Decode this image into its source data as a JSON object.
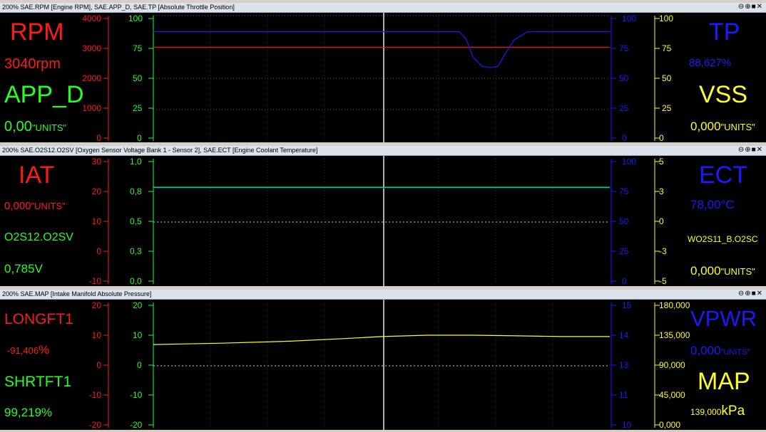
{
  "colors": {
    "red": "#ff1a1a",
    "green": "#22ff22",
    "blue": "#1a1aff",
    "yellow": "#ffff22",
    "gray": "#bdbdbd"
  },
  "window_controls": "⊖⊕■✕",
  "panels": [
    {
      "title": "200% SAE.RPM [Engine RPM], SAE.APP_D, SAE.TP [Absolute Throttle Position]",
      "left": {
        "name1": "RPM",
        "value1": "3040rpm",
        "name2": "APP_D",
        "value2": "0,00",
        "unit2": "\"UNITS\""
      },
      "right": {
        "name1": "TP",
        "value1": "88,627%",
        "name2": "VSS",
        "value2": "0,000",
        "unit2": "\"UNITS\""
      },
      "axis_red": [
        "4000",
        "3000",
        "2000",
        "1000",
        "0"
      ],
      "axis_green": [
        "100",
        "75",
        "50",
        "25",
        "0"
      ],
      "axis_blue": [
        "100",
        "75",
        "50",
        "25",
        "0"
      ],
      "axis_yellow": [
        "100",
        "75",
        "50",
        "25",
        "0"
      ]
    },
    {
      "title": "200% SAE.O2S12.O2SV [Oxygen Sensor Voltage Bank 1 - Sensor 2], SAE.ECT [Engine Coolant Temperature]",
      "left": {
        "name1": "IAT",
        "value1": "0,000",
        "unit1": "\"UNITS\"",
        "name2": "O2S12.O2SV",
        "value2": "0,785V"
      },
      "right": {
        "name1": "ECT",
        "value1": "78,00°C",
        "name2": "WO2S11_B.O2SC",
        "value2": "0,000",
        "unit2": "\"UNITS\""
      },
      "axis_red": [
        "30",
        "20",
        "10",
        "0",
        "-10"
      ],
      "axis_green": [
        "1,0",
        "0,8",
        "0,5",
        "0,3",
        "0,0"
      ],
      "axis_blue": [
        "100",
        "75",
        "50",
        "25",
        "0"
      ],
      "axis_yellow": [
        "5",
        "3",
        "0",
        "-3",
        "-5"
      ]
    },
    {
      "title": "200% SAE.MAP [Intake Manifold Absolute Pressure]",
      "left": {
        "name1": "LONGFT1",
        "value1": "-91,406",
        "unit1": "%",
        "name2": "SHRTFT1",
        "value2": "99,219%"
      },
      "right": {
        "name1": "VPWR",
        "value1": "0,000",
        "unit1": "\"UNITS\"",
        "name2": "MAP",
        "value2": "139,000",
        "unit2": "kPa"
      },
      "axis_red": [
        "20",
        "10",
        "0",
        "-10",
        "-20"
      ],
      "axis_green": [
        "20",
        "10",
        "0",
        "-10",
        "-20"
      ],
      "axis_blue": [
        "15",
        "14",
        "13",
        "11",
        "10"
      ],
      "axis_yellow": [
        "180,000",
        "135,000",
        "90,000",
        "45,000",
        "0,000"
      ]
    }
  ],
  "chart_data": [
    {
      "type": "line",
      "series": [
        {
          "name": "RPM",
          "axis": "red",
          "ylim": [
            0,
            4000
          ],
          "x": [
            0,
            100
          ],
          "y": [
            3040,
            3040
          ]
        },
        {
          "name": "TP",
          "axis": "blue",
          "ylim": [
            0,
            100
          ],
          "x": [
            0,
            67,
            68.5,
            70,
            72,
            74,
            75.5,
            77,
            79,
            82,
            100
          ],
          "y": [
            89,
            89,
            83,
            68,
            60,
            59,
            60,
            70,
            82,
            89,
            89
          ]
        }
      ]
    },
    {
      "type": "line",
      "series": [
        {
          "name": "ECT",
          "axis": "blue",
          "ylim": [
            0,
            100
          ],
          "x": [
            0,
            100
          ],
          "y": [
            78,
            78
          ]
        },
        {
          "name": "O2S12.O2SV",
          "axis": "green",
          "ylim": [
            0.0,
            1.0
          ],
          "x": [
            0,
            100
          ],
          "y": [
            0.785,
            0.785
          ]
        }
      ]
    },
    {
      "type": "line",
      "series": [
        {
          "name": "MAP",
          "axis": "yellow",
          "ylim": [
            0,
            180
          ],
          "x": [
            0,
            15,
            30,
            42,
            50,
            60,
            70,
            80,
            90,
            100
          ],
          "y": [
            121,
            123,
            126,
            130,
            133,
            135,
            135,
            134,
            133,
            133
          ]
        }
      ]
    }
  ]
}
